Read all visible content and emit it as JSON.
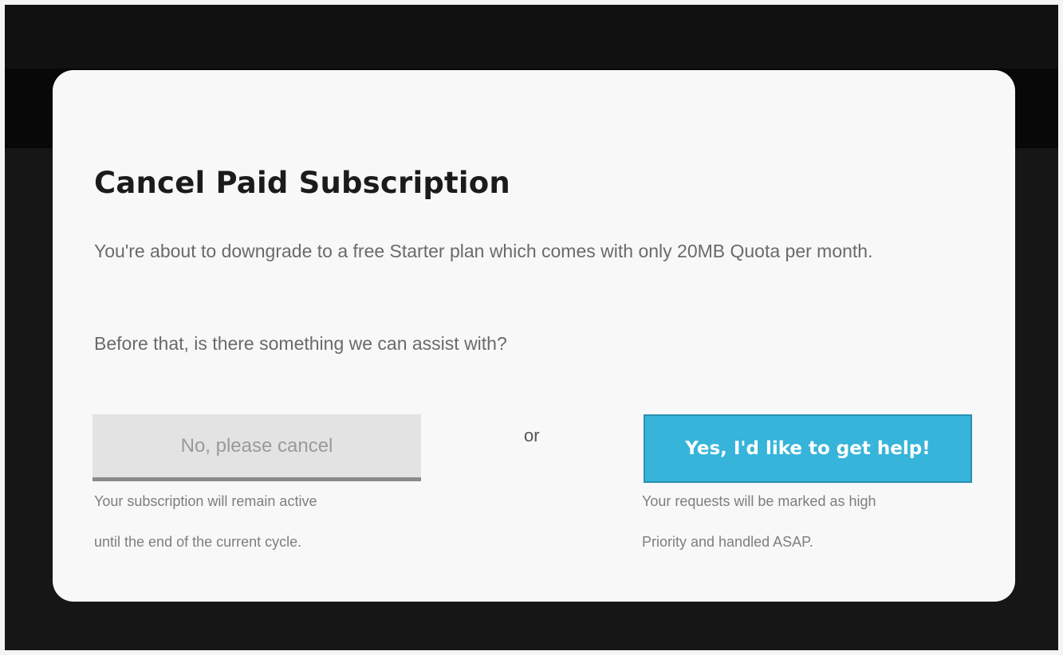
{
  "modal": {
    "title": "Cancel Paid Subscription",
    "intro": "You're about to downgrade to a free Starter plan which comes with only 20MB Quota per month.",
    "question": "Before that, is there something we can assist with?",
    "separator": "or",
    "cancel": {
      "label": "No, please cancel",
      "caption_line1": "Your subscription will remain active",
      "caption_line2": "until the end of the current cycle."
    },
    "help": {
      "label": "Yes, I'd like to get help!",
      "caption_line1": "Your requests will be marked as high",
      "caption_line2": "Priority and handled ASAP."
    }
  },
  "colors": {
    "backdrop": "#161616",
    "modal_background": "#f8f8f8",
    "title": "#1b1b1b",
    "body_text": "#6a6a6a",
    "cancel_button_background": "#e3e3e3",
    "help_button_background": "#36b4da"
  }
}
